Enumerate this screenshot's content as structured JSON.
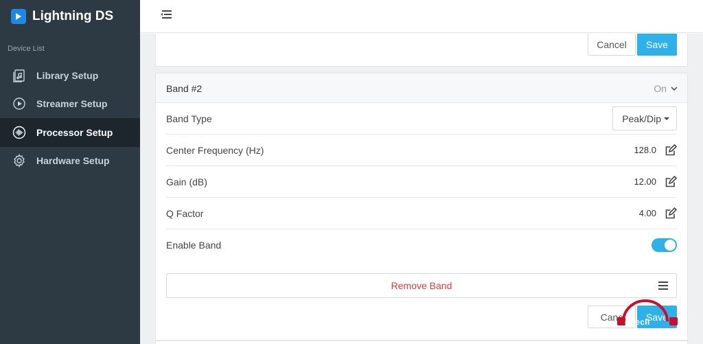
{
  "app": {
    "title": "Lightning DS"
  },
  "sidebar": {
    "section_label": "Device List",
    "items": [
      {
        "label": "Library Setup",
        "icon": "music-file-icon"
      },
      {
        "label": "Streamer Setup",
        "icon": "play-circle-icon"
      },
      {
        "label": "Processor Setup",
        "icon": "audio-wave-icon",
        "active": true
      },
      {
        "label": "Hardware Setup",
        "icon": "gear-icon"
      }
    ]
  },
  "top_panel": {
    "cancel_label": "Cancel",
    "save_label": "Save"
  },
  "band": {
    "title": "Band #2",
    "status": "On",
    "rows": {
      "band_type": {
        "label": "Band Type",
        "value": "Peak/Dip"
      },
      "center_frequency": {
        "label": "Center Frequency (Hz)",
        "value": "128.0"
      },
      "gain": {
        "label": "Gain (dB)",
        "value": "12.00"
      },
      "q_factor": {
        "label": "Q Factor",
        "value": "4.00"
      },
      "enable_band": {
        "label": "Enable Band",
        "enabled": true
      }
    },
    "remove_label": "Remove Band",
    "cancel_label": "Canc",
    "save_label": "Save"
  },
  "watermark": {
    "text": "onecli"
  },
  "colors": {
    "accent": "#2eb1e8",
    "sidebar_bg": "#2d3a44",
    "sidebar_active": "#1d262d",
    "danger": "#e53935"
  }
}
